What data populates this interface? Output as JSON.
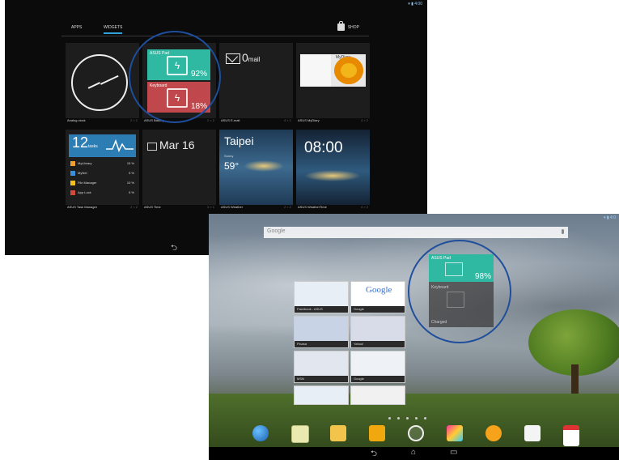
{
  "widgets_screen": {
    "tabs": [
      {
        "label": "APPS",
        "active": false
      },
      {
        "label": "WIDGETS",
        "active": true
      }
    ],
    "shop_label": "SHOP",
    "widgets": [
      {
        "name": "Analog clock",
        "size": "2 × 2"
      },
      {
        "name": "ASUS Battery",
        "size": "2 × 2",
        "battery_label": "ASUS Pad",
        "battery_value": "92%",
        "keyboard_label": "Keyboard",
        "keyboard_value": "18%"
      },
      {
        "name": "ASUS E-mail",
        "size": "4 × 1",
        "display_count": "0",
        "display_word": "mail"
      },
      {
        "name": "ASUS MyDiary",
        "size": "4 × 2",
        "display_title": "MyDiary"
      },
      {
        "name": "ASUS Task Manager",
        "size": "2 × 2",
        "task_count": "12",
        "task_unit": "tasks",
        "rows": [
          {
            "label": "MyLibrary",
            "value": "15 %"
          },
          {
            "label": "MyNet",
            "value": "5 %"
          },
          {
            "label": "File Manager",
            "value": "10 %"
          },
          {
            "label": "App Lock",
            "value": "5 %"
          }
        ]
      },
      {
        "name": "ASUS Time",
        "size": "3 × 1",
        "date": "Mar 16"
      },
      {
        "name": "ASUS Weather",
        "size": "2 × 2",
        "city": "Taipei",
        "condition": "Sunny",
        "temp": "59°"
      },
      {
        "name": "ASUS WeatherTime",
        "size": "4 × 2",
        "time": "08:00"
      }
    ],
    "nav_back": "⮌"
  },
  "home_screen": {
    "search_placeholder": "Google",
    "battery_widget": {
      "label": "ASUS Pad",
      "value": "98%",
      "keyboard_label": "Keyboard",
      "charge_label": "Charged"
    },
    "browser_cards": [
      {
        "caption": "Facebook - ASUS"
      },
      {
        "caption": "Google",
        "logo": "Google"
      },
      {
        "caption": "Picasa"
      },
      {
        "caption": "Yahoo!"
      },
      {
        "caption": "MSN"
      },
      {
        "caption": "Google"
      }
    ],
    "dock_icons": [
      "browser-icon",
      "gallery-icon",
      "email-icon",
      "files-icon",
      "all-apps-icon",
      "photos-icon",
      "music-icon",
      "play-store-icon",
      "gmail-icon"
    ],
    "nav": {
      "back": "⮌",
      "home": "⌂",
      "recents": "▭"
    }
  }
}
